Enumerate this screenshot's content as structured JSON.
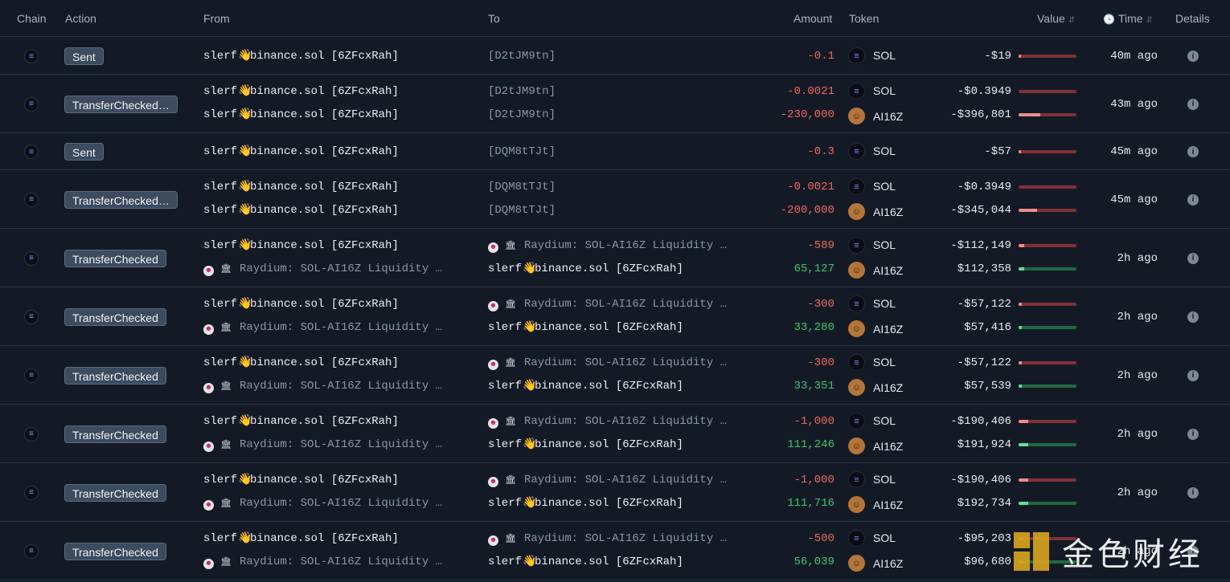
{
  "header": {
    "chain": "Chain",
    "action": "Action",
    "from": "From",
    "to": "To",
    "amount": "Amount",
    "token": "Token",
    "value": "Value",
    "time": "Time",
    "details": "Details",
    "sort_glyph": "⇵",
    "clock_glyph": "🕓"
  },
  "icons": {
    "chain": "solana-chain-icon",
    "sol": "solana-token-icon",
    "ai16z": "ai16z-token-icon",
    "info": "info-icon",
    "pool": "raydium-pool-icon",
    "contract": "contract-bank-icon"
  },
  "glyphs": {
    "chain": "≡",
    "info": "i",
    "pool": "☻",
    "bank": "🏛",
    "hand": "👋"
  },
  "addresses": {
    "slerf_prefix": "slerf",
    "slerf_suffix": "binance.sol [6ZFcxRah]",
    "pool": "Raydium: SOL-AI16Z Liquidity …",
    "d2t": "[D2tJM9tn]",
    "dqm": "[DQM8tTJt]"
  },
  "tokens": {
    "sol": "SOL",
    "ai16z": "AI16Z"
  },
  "colors": {
    "negative": "#f0655f",
    "positive": "#3ec46d",
    "badge_bg": "#3d4b5e",
    "background": "#131a26"
  },
  "rows": [
    {
      "action": "Sent",
      "time": "40m ago",
      "lines": [
        {
          "from": "slerf",
          "to": "d2t",
          "amount": "-0.1",
          "sign": "neg",
          "token": "sol",
          "value": "-$19",
          "bar": 0.01
        }
      ]
    },
    {
      "action": "TransferChecked…",
      "time": "43m ago",
      "lines": [
        {
          "from": "slerf",
          "to": "d2t",
          "amount": "-0.0021",
          "sign": "neg",
          "token": "sol",
          "value": "-$0.3949",
          "bar": 0.0
        },
        {
          "from": "slerf",
          "to": "d2t",
          "amount": "-230,000",
          "sign": "neg",
          "token": "ai16z",
          "value": "-$396,801",
          "bar": 0.37
        }
      ]
    },
    {
      "action": "Sent",
      "time": "45m ago",
      "lines": [
        {
          "from": "slerf",
          "to": "dqm",
          "amount": "-0.3",
          "sign": "neg",
          "token": "sol",
          "value": "-$57",
          "bar": 0.01
        }
      ]
    },
    {
      "action": "TransferChecked…",
      "time": "45m ago",
      "lines": [
        {
          "from": "slerf",
          "to": "dqm",
          "amount": "-0.0021",
          "sign": "neg",
          "token": "sol",
          "value": "-$0.3949",
          "bar": 0.0
        },
        {
          "from": "slerf",
          "to": "dqm",
          "amount": "-200,000",
          "sign": "neg",
          "token": "ai16z",
          "value": "-$345,044",
          "bar": 0.32
        }
      ]
    },
    {
      "action": "TransferChecked",
      "time": "2h ago",
      "lines": [
        {
          "from": "slerf",
          "to": "pool",
          "amount": "-589",
          "sign": "neg",
          "token": "sol",
          "value": "-$112,149",
          "bar": 0.1
        },
        {
          "from": "pool",
          "to": "slerf",
          "amount": "65,127",
          "sign": "pos",
          "token": "ai16z",
          "value": "$112,358",
          "bar": 0.1
        }
      ]
    },
    {
      "action": "TransferChecked",
      "time": "2h ago",
      "lines": [
        {
          "from": "slerf",
          "to": "pool",
          "amount": "-300",
          "sign": "neg",
          "token": "sol",
          "value": "-$57,122",
          "bar": 0.05
        },
        {
          "from": "pool",
          "to": "slerf",
          "amount": "33,280",
          "sign": "pos",
          "token": "ai16z",
          "value": "$57,416",
          "bar": 0.05
        }
      ]
    },
    {
      "action": "TransferChecked",
      "time": "2h ago",
      "lines": [
        {
          "from": "slerf",
          "to": "pool",
          "amount": "-300",
          "sign": "neg",
          "token": "sol",
          "value": "-$57,122",
          "bar": 0.05
        },
        {
          "from": "pool",
          "to": "slerf",
          "amount": "33,351",
          "sign": "pos",
          "token": "ai16z",
          "value": "$57,539",
          "bar": 0.05
        }
      ]
    },
    {
      "action": "TransferChecked",
      "time": "2h ago",
      "lines": [
        {
          "from": "slerf",
          "to": "pool",
          "amount": "-1,000",
          "sign": "neg",
          "token": "sol",
          "value": "-$190,406",
          "bar": 0.17
        },
        {
          "from": "pool",
          "to": "slerf",
          "amount": "111,246",
          "sign": "pos",
          "token": "ai16z",
          "value": "$191,924",
          "bar": 0.17
        }
      ]
    },
    {
      "action": "TransferChecked",
      "time": "2h ago",
      "lines": [
        {
          "from": "slerf",
          "to": "pool",
          "amount": "-1,000",
          "sign": "neg",
          "token": "sol",
          "value": "-$190,406",
          "bar": 0.17
        },
        {
          "from": "pool",
          "to": "slerf",
          "amount": "111,716",
          "sign": "pos",
          "token": "ai16z",
          "value": "$192,734",
          "bar": 0.17
        }
      ]
    },
    {
      "action": "TransferChecked",
      "time": "2h ago",
      "lines": [
        {
          "from": "slerf",
          "to": "pool",
          "amount": "-500",
          "sign": "neg",
          "token": "sol",
          "value": "-$95,203",
          "bar": 0.09
        },
        {
          "from": "pool",
          "to": "slerf",
          "amount": "56,039",
          "sign": "pos",
          "token": "ai16z",
          "value": "$96,680",
          "bar": 0.09
        }
      ]
    }
  ],
  "watermark": {
    "text": "金色财经",
    "logo": "jinse-logo-icon"
  }
}
